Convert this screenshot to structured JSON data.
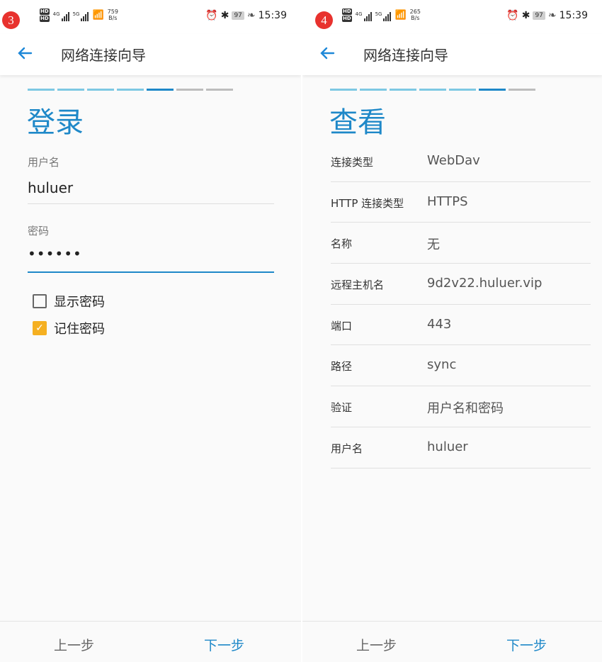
{
  "status": {
    "hd": "HD",
    "sig_4g": "4G",
    "sig_5g": "5G",
    "time": "15:39",
    "battery": "97"
  },
  "left": {
    "step_number": "3",
    "net_speed": "759",
    "speed_unit": "B/s",
    "app_title": "网络连接向导",
    "heading": "登录",
    "progress_colors": [
      "#7ec8e3",
      "#7ec8e3",
      "#7ec8e3",
      "#7ec8e3",
      "#1e88c8",
      "#bdbdbd",
      "#bdbdbd"
    ],
    "username_label": "用户名",
    "username_value": "huluer",
    "password_label": "密码",
    "password_value": "••••••",
    "show_password_label": "显示密码",
    "show_password_checked": false,
    "remember_password_label": "记住密码",
    "remember_password_checked": true,
    "prev_label": "上一步",
    "next_label": "下一步"
  },
  "right": {
    "step_number": "4",
    "net_speed": "265",
    "speed_unit": "B/s",
    "app_title": "网络连接向导",
    "heading": "查看",
    "progress_colors": [
      "#7ec8e3",
      "#7ec8e3",
      "#7ec8e3",
      "#7ec8e3",
      "#7ec8e3",
      "#1e88c8",
      "#bdbdbd"
    ],
    "rows": [
      {
        "key": "连接类型",
        "value": "WebDav"
      },
      {
        "key": "HTTP 连接类型",
        "value": "HTTPS"
      },
      {
        "key": "名称",
        "value": "无"
      },
      {
        "key": "远程主机名",
        "value": "9d2v22.huluer.vip"
      },
      {
        "key": "端口",
        "value": "443"
      },
      {
        "key": "路径",
        "value": "sync"
      },
      {
        "key": "验证",
        "value": "用户名和密码"
      },
      {
        "key": "用户名",
        "value": "huluer"
      }
    ],
    "prev_label": "上一步",
    "next_label": "下一步"
  },
  "accent_color": "#1e88c8",
  "check_color": "#f5b021"
}
